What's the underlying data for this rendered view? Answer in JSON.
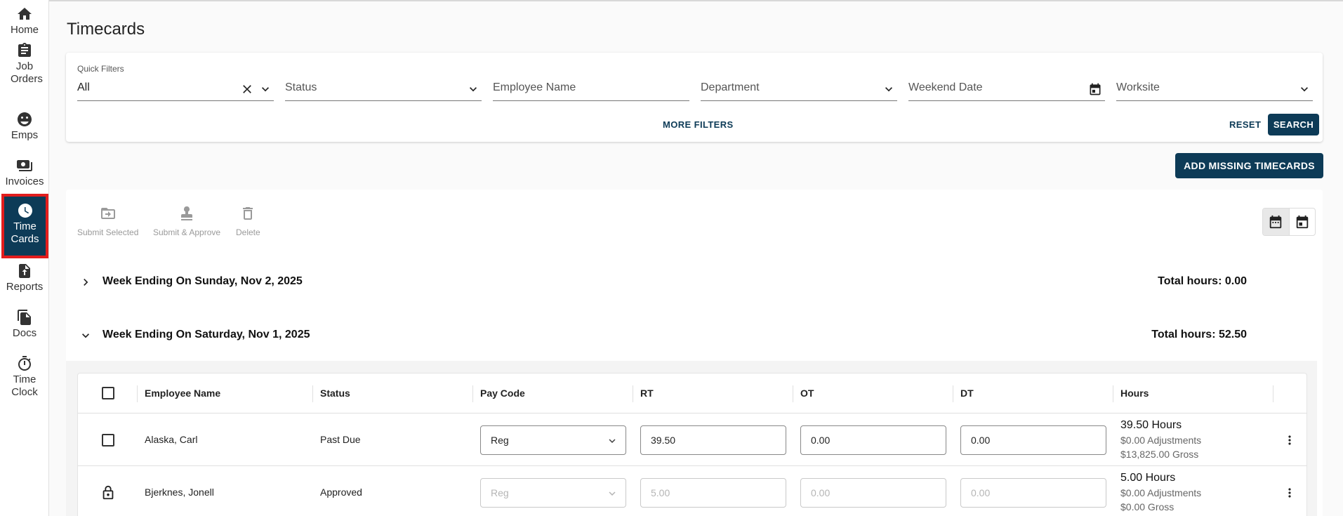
{
  "sidebar": {
    "items": [
      {
        "label": "Home",
        "icon": "home-icon"
      },
      {
        "label": "Job Orders",
        "icon": "clipboard-icon"
      },
      {
        "label": "Emps",
        "icon": "people-icon"
      },
      {
        "label": "Invoices",
        "icon": "money-icon"
      },
      {
        "label": "Time Cards",
        "icon": "clock-icon",
        "active": true
      },
      {
        "label": "Reports",
        "icon": "file-upload-icon"
      },
      {
        "label": "Docs",
        "icon": "documents-icon"
      },
      {
        "label": "Time Clock",
        "icon": "stopwatch-icon"
      }
    ],
    "active_color": "#0d3b57",
    "highlight_color": "#e21d1d"
  },
  "page": {
    "title": "Timecards"
  },
  "filters": {
    "quick_filters_label": "Quick Filters",
    "quick_filters_value": "All",
    "status_placeholder": "Status",
    "employee_name_placeholder": "Employee Name",
    "department_placeholder": "Department",
    "weekend_date_placeholder": "Weekend Date",
    "worksite_placeholder": "Worksite",
    "more_filters": "MORE FILTERS",
    "reset": "RESET",
    "search": "SEARCH"
  },
  "add_missing": "ADD MISSING TIMECARDS",
  "actions": {
    "submit_selected": "Submit Selected",
    "submit_approve": "Submit & Approve",
    "delete": "Delete"
  },
  "weeks": [
    {
      "title": "Week Ending On Sunday, Nov 2, 2025",
      "total": "Total hours: 0.00",
      "expanded": false
    },
    {
      "title": "Week Ending On Saturday, Nov 1, 2025",
      "total": "Total hours: 52.50",
      "expanded": true
    }
  ],
  "table": {
    "headers": {
      "employee_name": "Employee Name",
      "status": "Status",
      "pay_code": "Pay Code",
      "rt": "RT",
      "ot": "OT",
      "dt": "DT",
      "hours": "Hours"
    },
    "rows": [
      {
        "employee": "Alaska, Carl",
        "status": "Past Due",
        "pay_code": "Reg",
        "rt": "39.50",
        "ot": "0.00",
        "dt": "0.00",
        "hours": "39.50 Hours",
        "adjustments": "$0.00 Adjustments",
        "gross": "$13,825.00 Gross",
        "locked": false
      },
      {
        "employee": "Bjerknes, Jonell",
        "status": "Approved",
        "pay_code": "Reg",
        "rt": "5.00",
        "ot": "0.00",
        "dt": "0.00",
        "hours": "5.00 Hours",
        "adjustments": "$0.00 Adjustments",
        "gross": "$0.00 Gross",
        "locked": true
      }
    ]
  }
}
